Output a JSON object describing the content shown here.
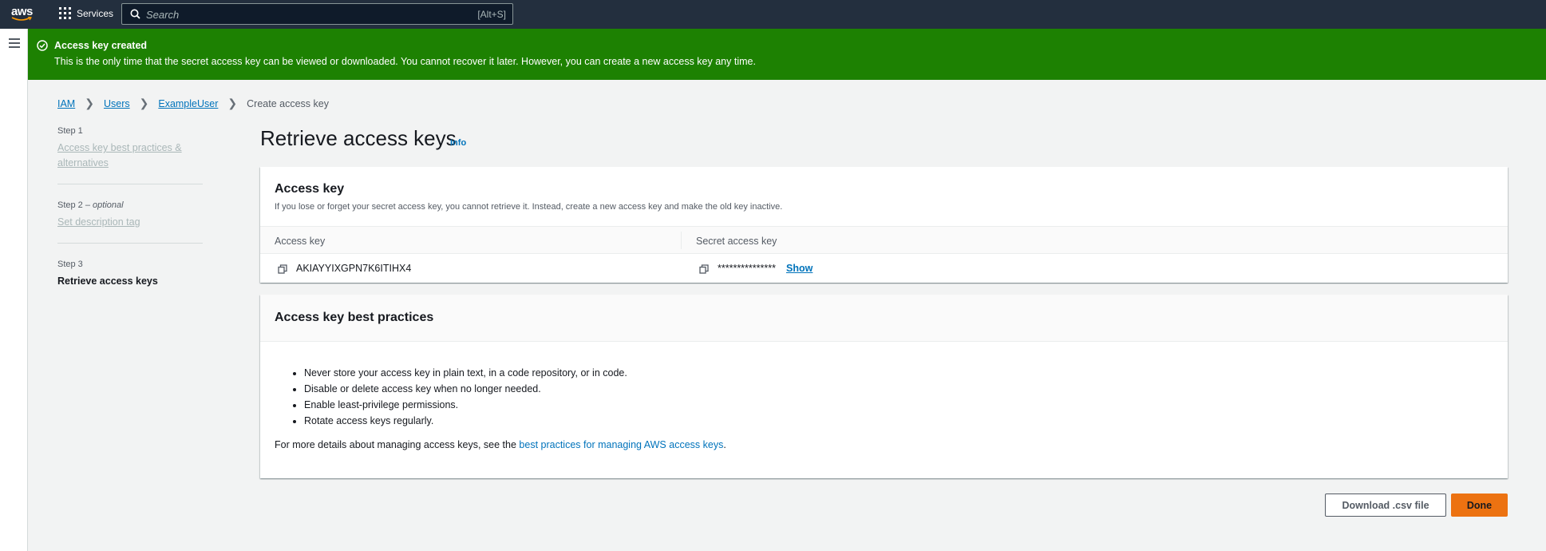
{
  "nav": {
    "logo_text": "aws",
    "services_label": "Services",
    "search_placeholder": "Search",
    "search_shortcut": "[Alt+S]"
  },
  "flash": {
    "title": "Access key created",
    "message": "This is the only time that the secret access key can be viewed or downloaded. You cannot recover it later. However, you can create a new access key any time."
  },
  "breadcrumb": {
    "items": [
      "IAM",
      "Users",
      "ExampleUser"
    ],
    "current": "Create access key"
  },
  "steps": [
    {
      "label": "Step 1",
      "optional": "",
      "name": "Access key best practices & alternatives"
    },
    {
      "label": "Step 2",
      "optional": "optional",
      "name": "Set description tag"
    },
    {
      "label": "Step 3",
      "optional": "",
      "name": "Retrieve access keys"
    }
  ],
  "page": {
    "title": "Retrieve access keys",
    "info_label": "Info"
  },
  "access_key_panel": {
    "title": "Access key",
    "description": "If you lose or forget your secret access key, you cannot retrieve it. Instead, create a new access key and make the old key inactive.",
    "col_access_key": "Access key",
    "col_secret": "Secret access key",
    "access_key_id": "AKIAYYIXGPN7K6ITIHX4",
    "secret_masked": "***************",
    "show_label": "Show"
  },
  "best_practices": {
    "title": "Access key best practices",
    "items": [
      "Never store your access key in plain text, in a code repository, or in code.",
      "Disable or delete access key when no longer needed.",
      "Enable least-privilege permissions.",
      "Rotate access keys regularly."
    ],
    "more_prefix": "For more details about managing access keys, see the ",
    "more_link": "best practices for managing AWS access keys",
    "more_suffix": "."
  },
  "footer": {
    "download_label": "Download .csv file",
    "done_label": "Done"
  },
  "colors": {
    "nav_bg": "#232f3e",
    "success": "#1d8102",
    "link": "#0073bb",
    "primary_button": "#ec7211"
  }
}
